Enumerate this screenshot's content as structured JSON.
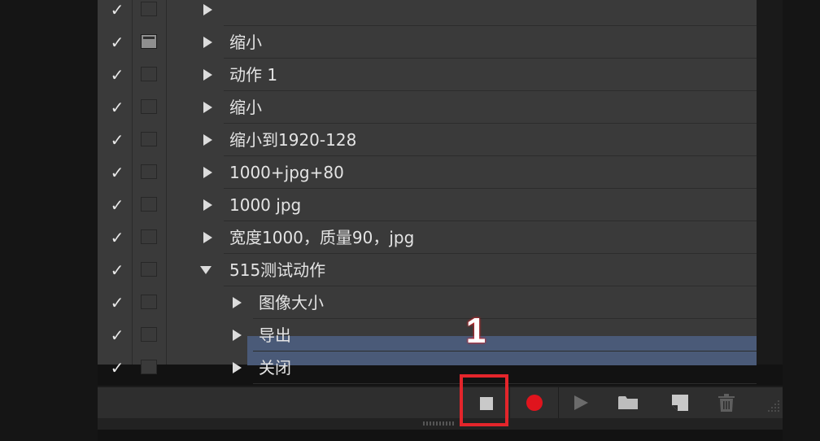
{
  "actions_panel": {
    "rows": [
      {
        "label": "",
        "checked": true,
        "dialog": false,
        "indent": 0,
        "expanded": false
      },
      {
        "label": "缩小",
        "checked": true,
        "dialog": true,
        "indent": 0,
        "expanded": false
      },
      {
        "label": "动作 1",
        "checked": true,
        "dialog": false,
        "indent": 0,
        "expanded": false
      },
      {
        "label": "缩小",
        "checked": true,
        "dialog": false,
        "indent": 0,
        "expanded": false
      },
      {
        "label": "缩小到1920-128",
        "checked": true,
        "dialog": false,
        "indent": 0,
        "expanded": false
      },
      {
        "label": "1000+jpg+80",
        "checked": true,
        "dialog": false,
        "indent": 0,
        "expanded": false
      },
      {
        "label": "1000 jpg",
        "checked": true,
        "dialog": false,
        "indent": 0,
        "expanded": false
      },
      {
        "label": "宽度1000，质量90，jpg",
        "checked": true,
        "dialog": false,
        "indent": 0,
        "expanded": false
      },
      {
        "label": "515测试动作",
        "checked": true,
        "dialog": false,
        "indent": 0,
        "expanded": true
      },
      {
        "label": "图像大小",
        "checked": true,
        "dialog": false,
        "indent": 1,
        "expanded": false
      },
      {
        "label": "导出",
        "checked": true,
        "dialog": false,
        "indent": 1,
        "expanded": false
      },
      {
        "label": "关闭",
        "checked": true,
        "dialog": false,
        "indent": 1,
        "expanded": false,
        "selected": true
      }
    ],
    "check_glyph": "✓"
  },
  "toolbar": {
    "buttons": [
      "stop-recording",
      "begin-recording",
      "play-selection",
      "create-new-set",
      "create-new-action",
      "delete"
    ],
    "record_color": "#e0141d"
  },
  "annotation": {
    "number": "1",
    "color": "#e3252b"
  },
  "colors": {
    "panel_bg": "#3a3a3a",
    "selected_row": "#4a5a78"
  }
}
